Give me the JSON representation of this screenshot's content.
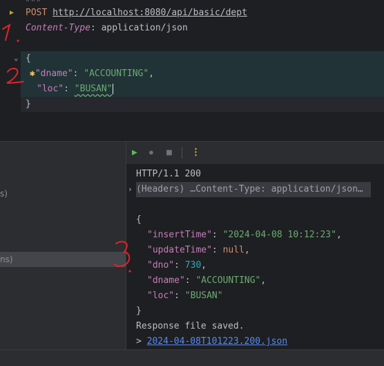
{
  "editor": {
    "request_line": {
      "method": "POST",
      "url": "http://localhost:8080/api/basic/dept"
    },
    "header_line": {
      "name": "Content-Type",
      "colon": ": ",
      "value": "application/json"
    },
    "body": {
      "open": "{",
      "dname_key": "\"dname\"",
      "dname_value": "\"ACCOUNTING\"",
      "loc_key": "\"loc\"",
      "loc_value": "\"BUSAN\"",
      "close": "}"
    }
  },
  "left_panel": {
    "items": [
      "s)",
      "ns)"
    ]
  },
  "toolbar": {
    "run_icon": "play-icon",
    "debug_icon": "bug-icon",
    "stop_icon": "stop-icon",
    "more_icon": "kebab-icon"
  },
  "response": {
    "status_line": "HTTP/1.1 200",
    "headers_summary": "(Headers) …Content-Type: application/json…",
    "open": "{",
    "insertTime_key": "\"insertTime\"",
    "insertTime_value": "\"2024-04-08 10:12:23\"",
    "updateTime_key": "\"updateTime\"",
    "updateTime_value": "null",
    "dno_key": "\"dno\"",
    "dno_value": "730",
    "dname_key": "\"dname\"",
    "dname_value": "\"ACCOUNTING\"",
    "loc_key": "\"loc\"",
    "loc_value": "\"BUSAN\"",
    "close": "}",
    "saved_message": "Response file saved.",
    "file_prefix": "> ",
    "file_link": "2024-04-08T101223.200.json"
  },
  "annotations": {
    "mark_1": "1.",
    "mark_2": "2",
    "mark_3": "3."
  },
  "colors": {
    "background": "#1e1f22",
    "panel": "#2b2d30",
    "keyword": "#cf8e6d",
    "json_key": "#c77dbb",
    "string": "#6aab73",
    "number": "#2aacb8",
    "link": "#548af7",
    "run_green": "#5fb865",
    "pen_red": "#e0242a"
  }
}
